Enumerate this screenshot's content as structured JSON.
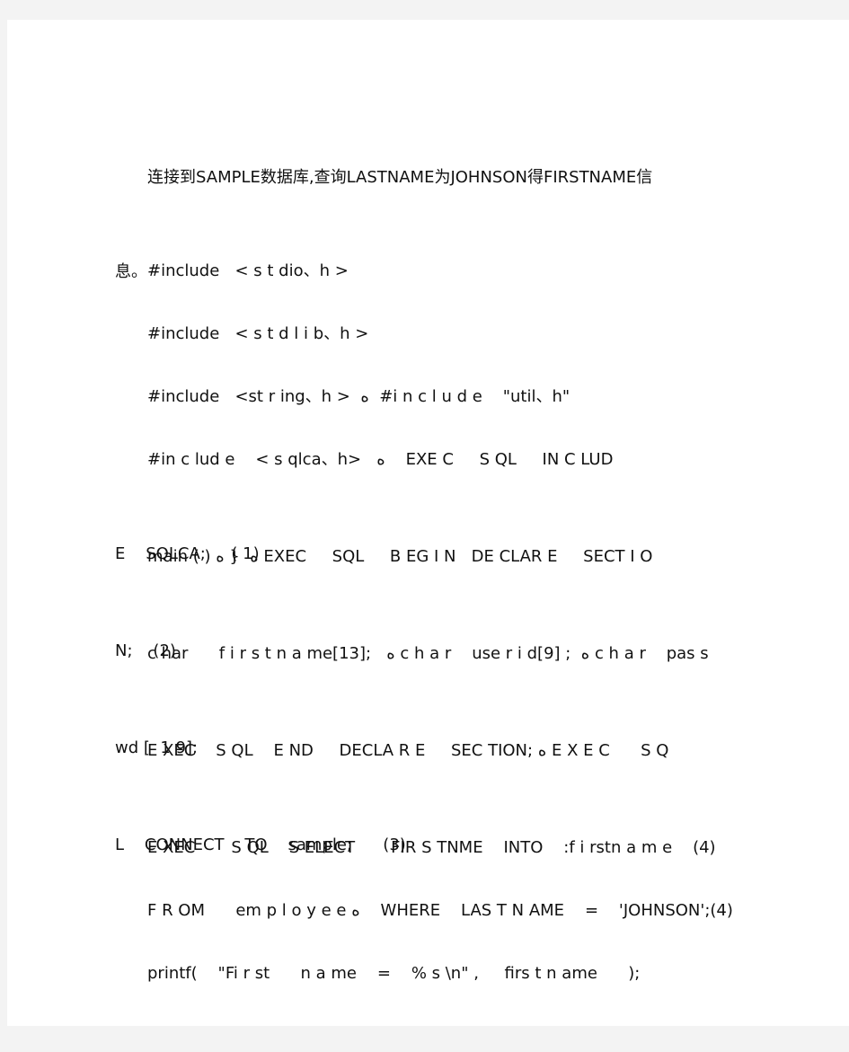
{
  "document": {
    "paragraphs": [
      {
        "lines": [
          "连接到SAMPLE数据库,查询LASTNAME为JOHNSON得FIRSTNAME信",
          "息。"
        ]
      },
      {
        "lines": [
          "#include   < s t dio、h >"
        ]
      },
      {
        "lines": [
          "#include   < s t d l i b、h >"
        ]
      },
      {
        "lines": [
          "#include   <st r ing、h >  ﻩ  #i n c l u d e    \"util、h\""
        ]
      },
      {
        "lines": [
          "#in c lud e    < s qlca、h>   ﻩ    EXE C     S QL     IN C LUD",
          "E    SQLCA;     ( 1)"
        ]
      },
      {
        "lines": [
          "main ( ) ﻩ  { ﻩ EXEC     SQL     B EG I N   DE CLAR E     SECT I O",
          "N;    (2)"
        ]
      },
      {
        "lines": [
          "c har      f i r s t n a me[13];   ﻩ c h a r    use r i d[9] ;  ﻩ c h a r    pas s",
          "wd [  1 9];"
        ]
      },
      {
        "lines": [
          "E XEC    S QL    E ND     DECLA R E     SEC TION; ﻩ E X E C      S Q",
          "L    CONNECT    TO    sample;      (3)"
        ]
      },
      {
        "lines": [
          "E XEC       S QL    S ELECT       FIR S TNME    INTO    :f i rstn a m e    (4)"
        ]
      },
      {
        "lines": [
          "F R OM      em p l o y e e ﻩ    WHERE    LAS T N AME    =    'JOHNSON';(4)"
        ]
      },
      {
        "lines": [
          "printf(    \"Fi r st      n a me    =    % s \\n\" ,     firs t n ame      );"
        ]
      }
    ]
  }
}
